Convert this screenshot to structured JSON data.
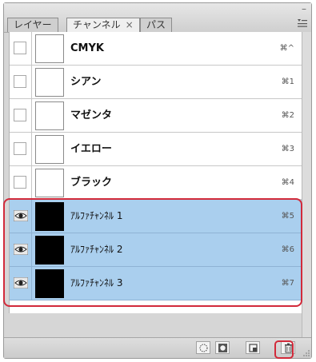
{
  "tabs": [
    {
      "label": "レイヤー",
      "active": false
    },
    {
      "label": "チャンネル",
      "active": true,
      "close": "×"
    },
    {
      "label": "パス",
      "active": false
    }
  ],
  "window": {
    "close_glyph": "–",
    "menu_icon": "panel-menu-icon"
  },
  "channels": [
    {
      "name": "CMYK",
      "shortcut": "⌘^",
      "visible": false,
      "thumbnail": "white",
      "selected": false
    },
    {
      "name": "シアン",
      "shortcut": "⌘1",
      "visible": false,
      "thumbnail": "white",
      "selected": false
    },
    {
      "name": "マゼンタ",
      "shortcut": "⌘2",
      "visible": false,
      "thumbnail": "white",
      "selected": false
    },
    {
      "name": "イエロー",
      "shortcut": "⌘3",
      "visible": false,
      "thumbnail": "white",
      "selected": false
    },
    {
      "name": "ブラック",
      "shortcut": "⌘4",
      "visible": false,
      "thumbnail": "white",
      "selected": false
    },
    {
      "name": "ｱﾙﾌｧﾁｬﾝﾈﾙ 1",
      "shortcut": "⌘5",
      "visible": true,
      "thumbnail": "black",
      "selected": true
    },
    {
      "name": "ｱﾙﾌｧﾁｬﾝﾈﾙ 2",
      "shortcut": "⌘6",
      "visible": true,
      "thumbnail": "black",
      "selected": true
    },
    {
      "name": "ｱﾙﾌｧﾁｬﾝﾈﾙ 3",
      "shortcut": "⌘7",
      "visible": true,
      "thumbnail": "black",
      "selected": true
    }
  ],
  "bottom_buttons": [
    {
      "icon": "load-selection-icon"
    },
    {
      "icon": "save-selection-icon"
    },
    {
      "icon": "new-channel-icon"
    },
    {
      "icon": "trash-icon"
    }
  ],
  "colors": {
    "selection": "#aacfee",
    "highlight": "#d22a3a"
  }
}
